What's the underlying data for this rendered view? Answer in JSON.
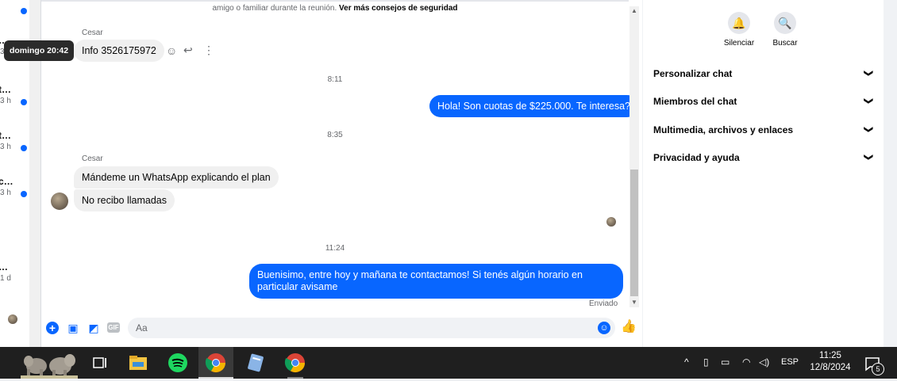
{
  "left_list": [
    {
      "title": "…",
      "meta": "3 h"
    },
    {
      "title": "t…",
      "meta": "3 h"
    },
    {
      "title": "t…",
      "meta": "3 h"
    },
    {
      "title": "c…",
      "meta": "3 h"
    },
    {
      "title": "…",
      "meta": "1 d"
    }
  ],
  "chat": {
    "safety_text": "amigo o familiar durante la reunión.",
    "safety_link": "Ver más consejos de seguridad",
    "tooltip": "domingo 20:42",
    "sender_1": "Cesar",
    "msg_1": "Info 3526175972",
    "time_1": "8:11",
    "out_1": "Hola! Son cuotas de $225.000. Te interesa?",
    "time_2": "8:35",
    "sender_2": "Cesar",
    "msg_2": "Mándeme un WhatsApp explicando el plan",
    "msg_3": "No recibo llamadas",
    "time_3": "11:24",
    "out_2": "Buenisimo, entre hoy y mañana te contactamos! Si tenés algún horario en particular avisame",
    "sent_status": "Enviado"
  },
  "composer": {
    "placeholder": "Aa"
  },
  "right_panel": {
    "actions": [
      {
        "label": "Silenciar",
        "icon": "bell-icon"
      },
      {
        "label": "Buscar",
        "icon": "search-icon"
      }
    ],
    "sections": [
      "Personalizar chat",
      "Miembros del chat",
      "Multimedia, archivos y enlaces",
      "Privacidad y ayuda"
    ]
  },
  "taskbar": {
    "language": "ESP",
    "time": "11:25",
    "date": "12/8/2024",
    "notifications": "5"
  },
  "colors": {
    "accent": "#0866ff",
    "bubble_in": "#f0f0f0",
    "taskbar": "#1f1f1f"
  }
}
